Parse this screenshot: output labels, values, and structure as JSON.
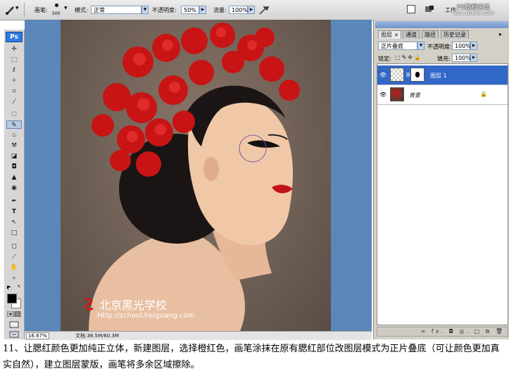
{
  "options_bar": {
    "brush_label": "画笔:",
    "brush_size": "500",
    "mode_label": "模式:",
    "mode_value": "正常",
    "opacity_label": "不透明度:",
    "opacity_value": "50%",
    "flow_label": "流量:",
    "flow_value": "100%",
    "workspace_label": "工作",
    "watermark": "PS教程论坛",
    "watermark_url": "BBS.16XX8.COM"
  },
  "toolbox": {
    "logo": "Ps",
    "tools": [
      "▸✢",
      "⬚",
      "ℓ",
      "✧",
      "⌗",
      "⁄",
      "◌",
      "✎",
      "♨",
      "⚒",
      "◪",
      "◘",
      "▲",
      "◉",
      "✒",
      "T",
      "↖",
      "□",
      "◻",
      "⟋",
      "✋",
      "🔍"
    ]
  },
  "status_bar": {
    "zoom": "16.67%",
    "doc_size": "文档:38.5M/60.3M"
  },
  "photo_watermark": {
    "school_name": "北京黑光学校",
    "school_url": "Http://school.heiguang.com"
  },
  "layers_panel": {
    "tabs": [
      "图层",
      "通道",
      "路径",
      "历史记录"
    ],
    "blend_mode": "正片叠底",
    "opacity_label": "不透明度:",
    "opacity_value": "100%",
    "lock_label": "锁定:",
    "fill_label": "填充:",
    "fill_value": "100%",
    "layers": [
      {
        "name": "图层 1",
        "selected": true
      },
      {
        "name": "背景",
        "selected": false
      }
    ],
    "footer_icons": "∞ fx. ◘ ◎. □ ⧉ 🗑"
  },
  "caption": "11、让腮红颜色更加纯正立体，新建图层，选择橙红色，画笔涂抹在原有腮红部位改图层模式为正片叠底（可让颜色更加真实自然），建立图层蒙版，画笔将多余区域擦除。"
}
